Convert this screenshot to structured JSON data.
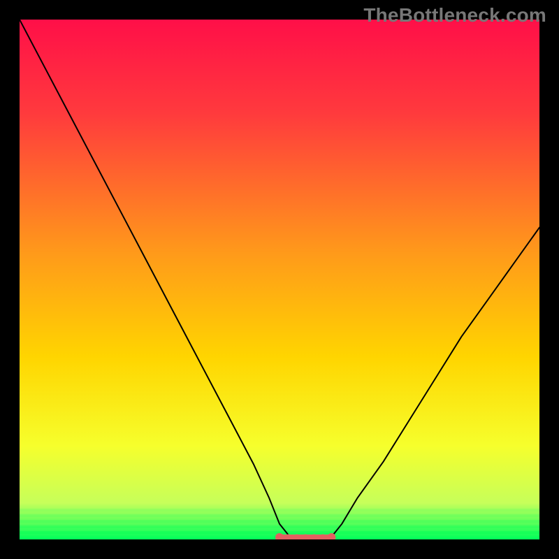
{
  "watermark": "TheBottleneck.com",
  "chart_data": {
    "type": "line",
    "title": "",
    "xlabel": "",
    "ylabel": "",
    "xlim": [
      0,
      100
    ],
    "ylim": [
      0,
      100
    ],
    "grid": false,
    "series": [
      {
        "name": "curve",
        "x": [
          0,
          5,
          10,
          15,
          20,
          25,
          30,
          35,
          40,
          45,
          48,
          50,
          52,
          55,
          58,
          60,
          62,
          65,
          70,
          75,
          80,
          85,
          90,
          95,
          100
        ],
        "y": [
          100,
          90.5,
          81,
          71.5,
          62,
          52.5,
          43,
          33.5,
          24,
          14.5,
          8,
          3,
          0.5,
          0,
          0,
          0.5,
          3,
          8,
          15,
          23,
          31,
          39,
          46,
          53,
          60
        ]
      }
    ],
    "highlight": {
      "name": "flat-minimum",
      "x_range": [
        50,
        60
      ],
      "y": 0
    },
    "background_gradient": {
      "top": "#ff0f48",
      "middle": "#ffd500",
      "bottom": "#00ff5a"
    },
    "colors": {
      "curve": "#000000",
      "highlight": "#e26060"
    }
  }
}
